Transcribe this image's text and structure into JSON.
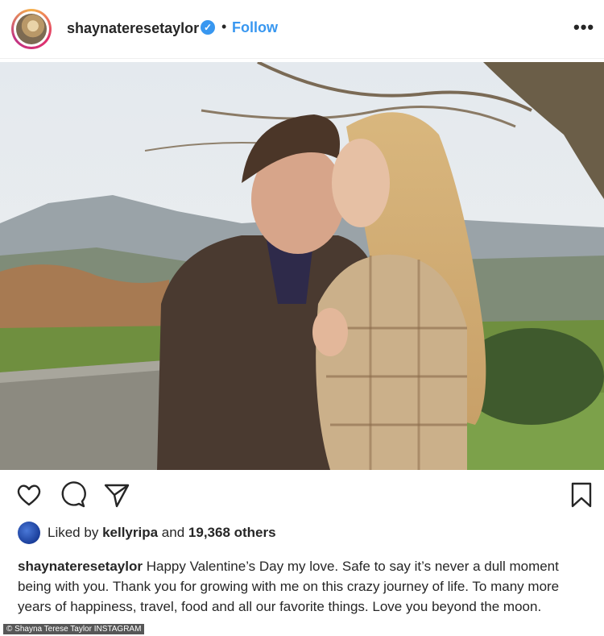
{
  "header": {
    "username": "shaynateresetaylor",
    "separator": "•",
    "follow_label": "Follow",
    "more_label": "•••",
    "verified_mark": "✓",
    "icons": {
      "avatar": "profile-avatar",
      "verified": "verified-badge-icon",
      "more": "more-options-icon"
    }
  },
  "post": {
    "image_description_icon": "photo"
  },
  "actions": {
    "icons": [
      "heart-icon",
      "comment-icon",
      "share-icon",
      "bookmark-icon"
    ]
  },
  "likes": {
    "prefix": "Liked by",
    "user": "kellyripa",
    "middle": "and",
    "others": "19,368 others"
  },
  "caption": {
    "username": "shaynateresetaylor",
    "text": "Happy Valentine’s Day my love. Safe to say it’s never a dull moment being with you. Thank you for growing with me on this crazy journey of life. To many more years of happiness, travel, food and all our favorite things. Love you beyond the moon."
  },
  "credit": "© Shayna Terese Taylor INSTAGRAM",
  "colors": {
    "link_blue": "#3897f0",
    "text": "#262626",
    "divider": "#efefef"
  }
}
